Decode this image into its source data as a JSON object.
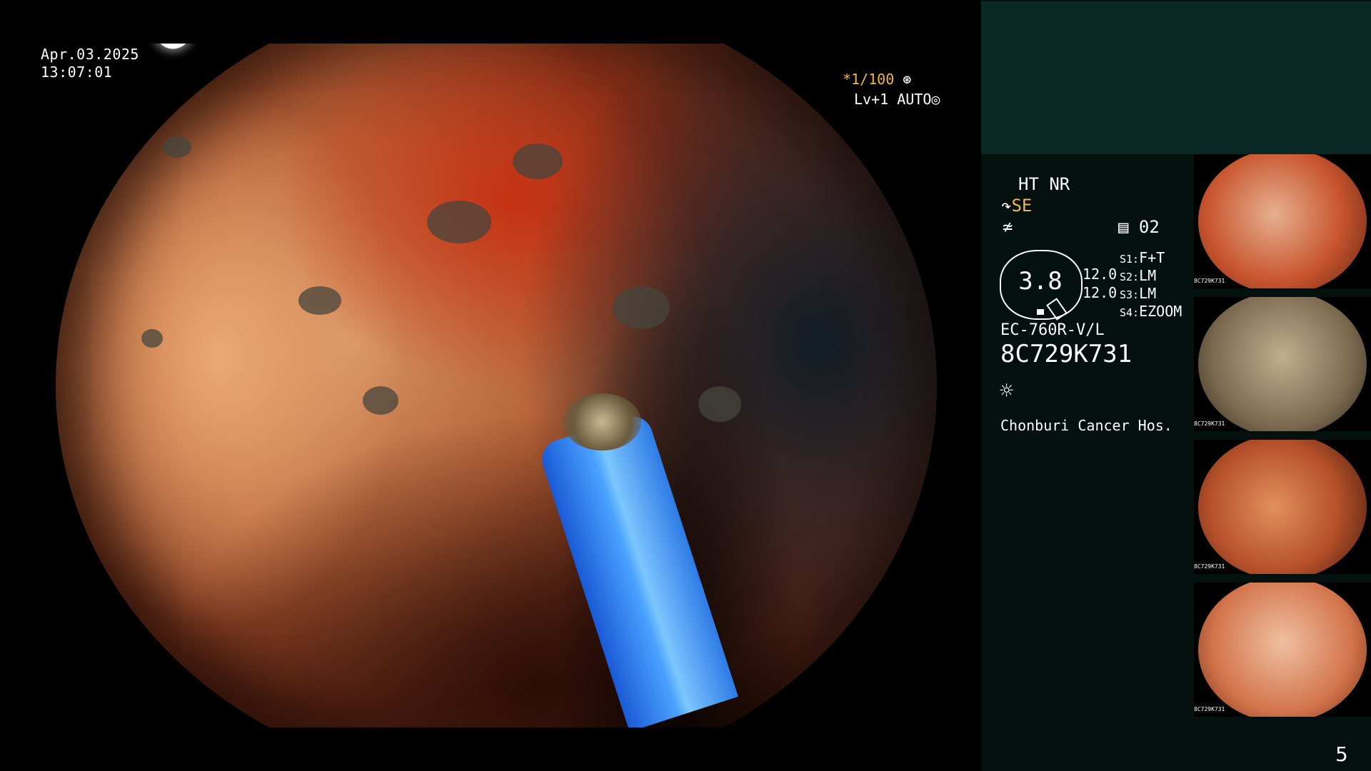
{
  "datetime": {
    "date": "Apr.03.2025",
    "time": "13:07:01"
  },
  "shutter": {
    "value": "*1/100",
    "icon": "shutter-icon"
  },
  "exposure": {
    "level": "Lv+1",
    "mode": "AUTO",
    "icon": "iris-icon"
  },
  "settings": {
    "mode": "HT NR",
    "enhance_icon": "gamma-icon",
    "enhance": "SE",
    "freeze_icon": "f-icon",
    "meter_icon": "memory-icon",
    "meter": "02",
    "gauge_value": "3.8",
    "aux_values": [
      "12.0",
      "12.0"
    ],
    "switches": [
      {
        "key": "S1:",
        "value": "F+T"
      },
      {
        "key": "S2:",
        "value": "LM"
      },
      {
        "key": "S3:",
        "value": "LM"
      },
      {
        "key": "S4:",
        "value": "EZOOM"
      }
    ],
    "scope_model": "EC-760R-V/L",
    "scope_serial": "8C729K731",
    "light_icon": "sun-icon",
    "hospital": "Chonburi Cancer Hos."
  },
  "thumbnails": [
    {
      "serial": "8C729K731"
    },
    {
      "serial": "8C729K731"
    },
    {
      "serial": "8C729K731"
    },
    {
      "serial": "8C729K731"
    }
  ],
  "page_number": "5",
  "colors": {
    "accent_orange": "#f2b648",
    "panel_top": "#0a2826",
    "panel_bg": "#03100d"
  }
}
